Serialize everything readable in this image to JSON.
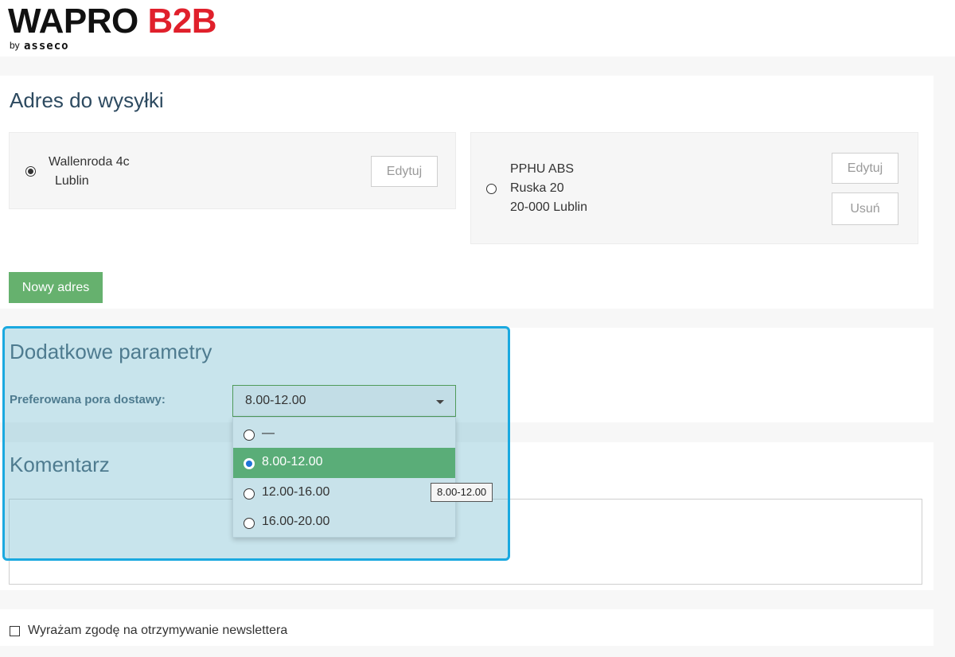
{
  "header": {
    "logo_text": "WAPRO",
    "logo_accent": "B2B",
    "logo_by": "by",
    "logo_brand": "asseco"
  },
  "shipping": {
    "title": "Adres do wysyłki",
    "addresses": [
      {
        "line1": "Wallenroda 4c",
        "line2": "Lublin",
        "line3": "",
        "selected": true,
        "edit_label": "Edytuj"
      },
      {
        "line1": "PPHU ABS",
        "line2": "Ruska 20",
        "line3": "20-000  Lublin",
        "selected": false,
        "edit_label": "Edytuj",
        "delete_label": "Usuń"
      }
    ],
    "new_address_label": "Nowy adres"
  },
  "params": {
    "title": "Dodatkowe parametry",
    "delivery_label": "Preferowana pora dostawy:",
    "selected_value": "8.00-12.00",
    "options": [
      "—",
      "8.00-12.00",
      "12.00-16.00",
      "16.00-20.00"
    ],
    "selected_index": 1,
    "tooltip": "8.00-12.00"
  },
  "comment": {
    "title": "Komentarz",
    "value": ""
  },
  "newsletter": {
    "label": "Wyrażam zgodę na otrzymywanie newslettera",
    "checked": false
  },
  "colors": {
    "brand_red": "#e0202b",
    "accent_green": "#66b16e",
    "highlight_blue": "#1aa9e0",
    "heading": "#2d4a60"
  }
}
